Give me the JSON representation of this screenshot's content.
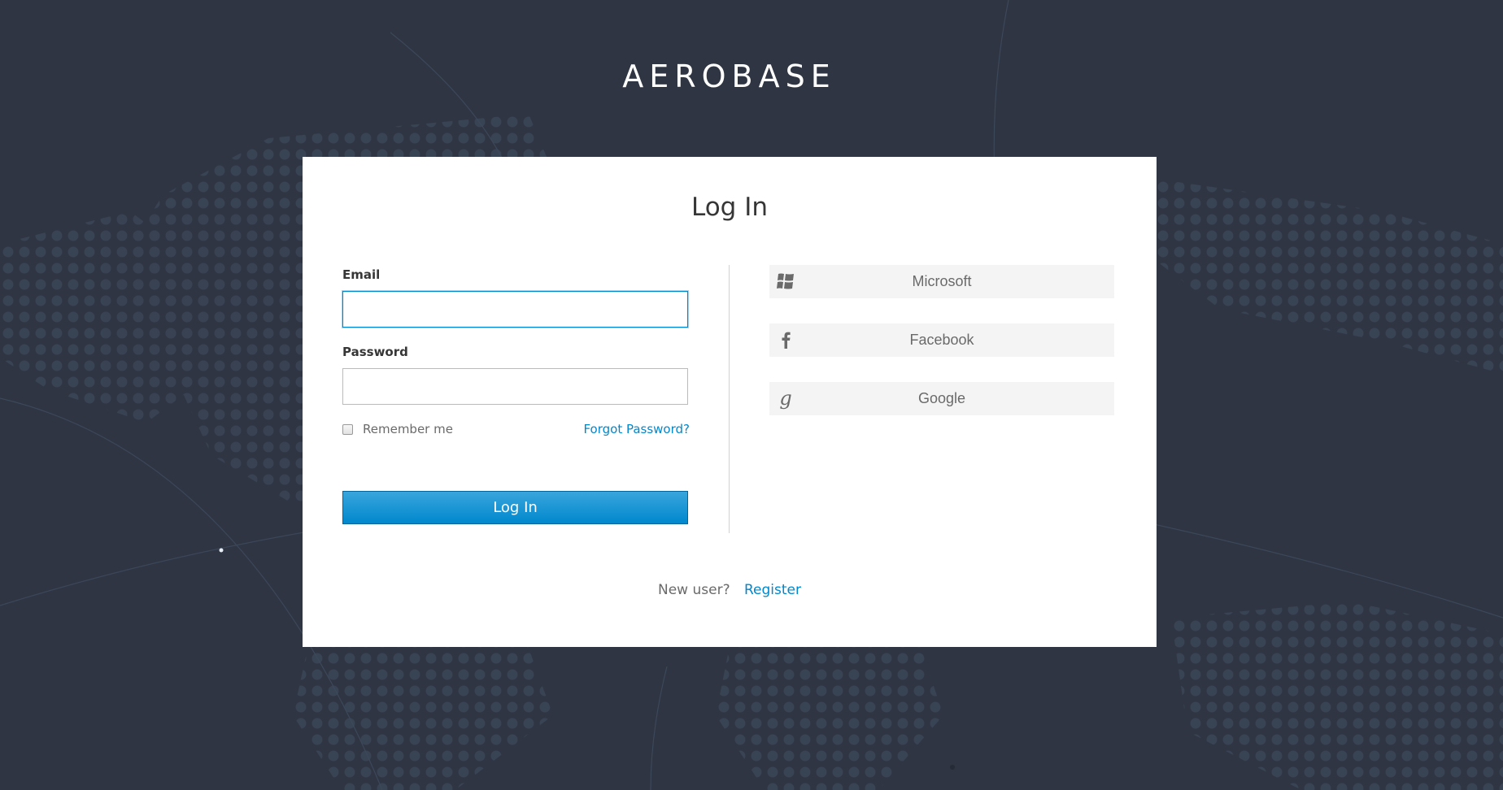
{
  "brand": {
    "title": "AEROBASE"
  },
  "login": {
    "heading": "Log In",
    "email_label": "Email",
    "email_value": "",
    "password_label": "Password",
    "password_value": "",
    "remember_label": "Remember me",
    "remember_checked": false,
    "forgot_label": "Forgot Password?",
    "submit_label": "Log In"
  },
  "social": {
    "providers": [
      {
        "label": "Microsoft",
        "icon": "windows-icon"
      },
      {
        "label": "Facebook",
        "icon": "facebook-icon"
      },
      {
        "label": "Google",
        "icon": "google-icon"
      }
    ]
  },
  "footer": {
    "new_user_text": "New user?",
    "register_label": "Register"
  },
  "colors": {
    "background": "#2f3542",
    "card": "#ffffff",
    "accent": "#0088ce",
    "social_button": "#f4f4f4"
  }
}
